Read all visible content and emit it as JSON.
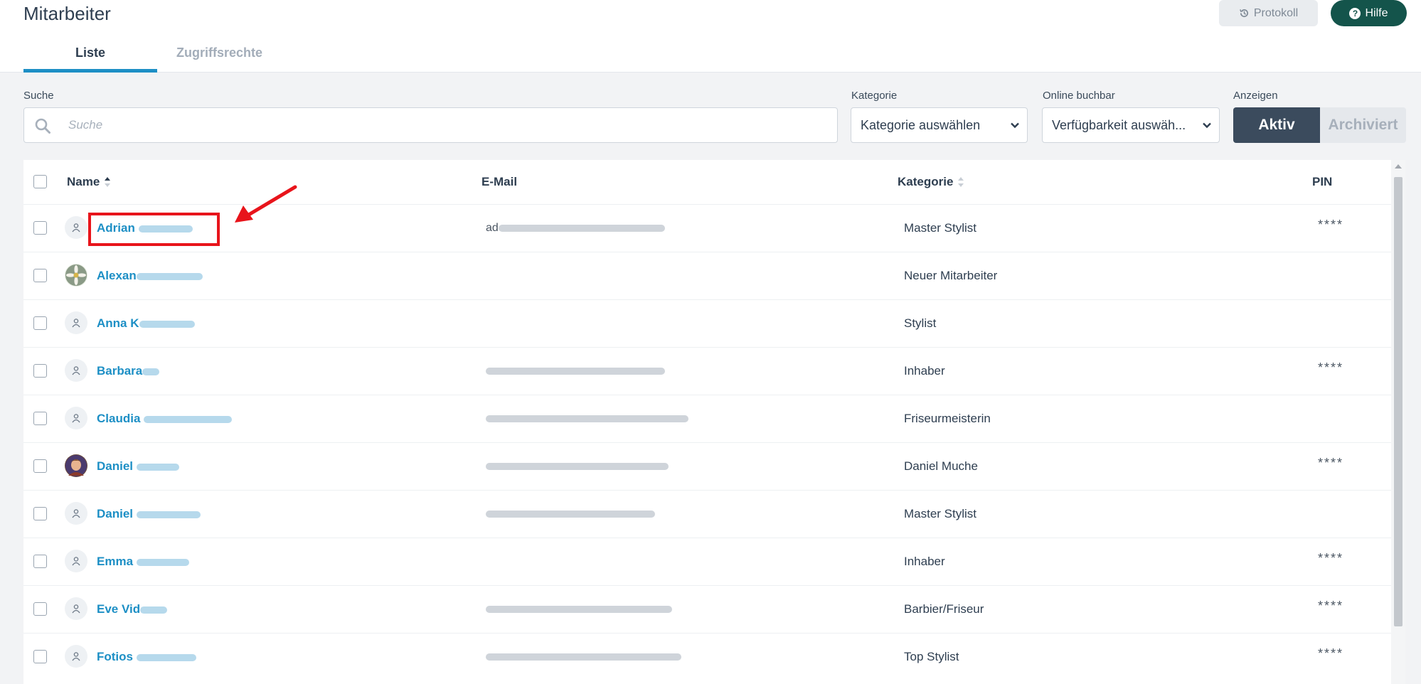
{
  "header": {
    "title": "Mitarbeiter",
    "protokoll_label": "Protokoll",
    "hilfe_label": "Hilfe"
  },
  "tabs": [
    {
      "label": "Liste",
      "active": true
    },
    {
      "label": "Zugriffsrechte",
      "active": false
    }
  ],
  "filters": {
    "search_label": "Suche",
    "search_placeholder": "Suche",
    "kategorie_label": "Kategorie",
    "kategorie_value": "Kategorie auswählen",
    "online_label": "Online buchbar",
    "online_value": "Verfügbarkeit auswäh...",
    "anzeigen_label": "Anzeigen",
    "aktiv_label": "Aktiv",
    "archiviert_label": "Archiviert"
  },
  "table": {
    "columns": [
      "Name",
      "E-Mail",
      "Kategorie",
      "PIN"
    ],
    "rows": [
      {
        "name": "Adrian",
        "email": "ad",
        "kategorie": "Master Stylist",
        "pin": "****"
      },
      {
        "name": "Alexan",
        "email": "",
        "kategorie": "Neuer Mitarbeiter",
        "pin": ""
      },
      {
        "name": "Anna K",
        "email": "",
        "kategorie": "Stylist",
        "pin": ""
      },
      {
        "name": "Barbara",
        "email": "",
        "kategorie": "Inhaber",
        "pin": "****"
      },
      {
        "name": "Claudia",
        "email": "",
        "kategorie": "Friseurmeisterin",
        "pin": ""
      },
      {
        "name": "Daniel",
        "email": "",
        "kategorie": "Daniel Muche",
        "pin": "****"
      },
      {
        "name": "Daniel",
        "email": "",
        "kategorie": "Master Stylist",
        "pin": ""
      },
      {
        "name": "Emma",
        "email": "",
        "kategorie": "Inhaber",
        "pin": "****"
      },
      {
        "name": "Eve Vid",
        "email": "",
        "kategorie": "Barbier/Friseur",
        "pin": "****"
      },
      {
        "name": "Fotios",
        "email": "",
        "kategorie": "Top Stylist",
        "pin": "****"
      }
    ]
  },
  "colors": {
    "accent": "#1d8fc5",
    "hilfe_bg": "#14544b",
    "toggle_active": "#3b4b5d",
    "annotation": "#e8141b"
  }
}
